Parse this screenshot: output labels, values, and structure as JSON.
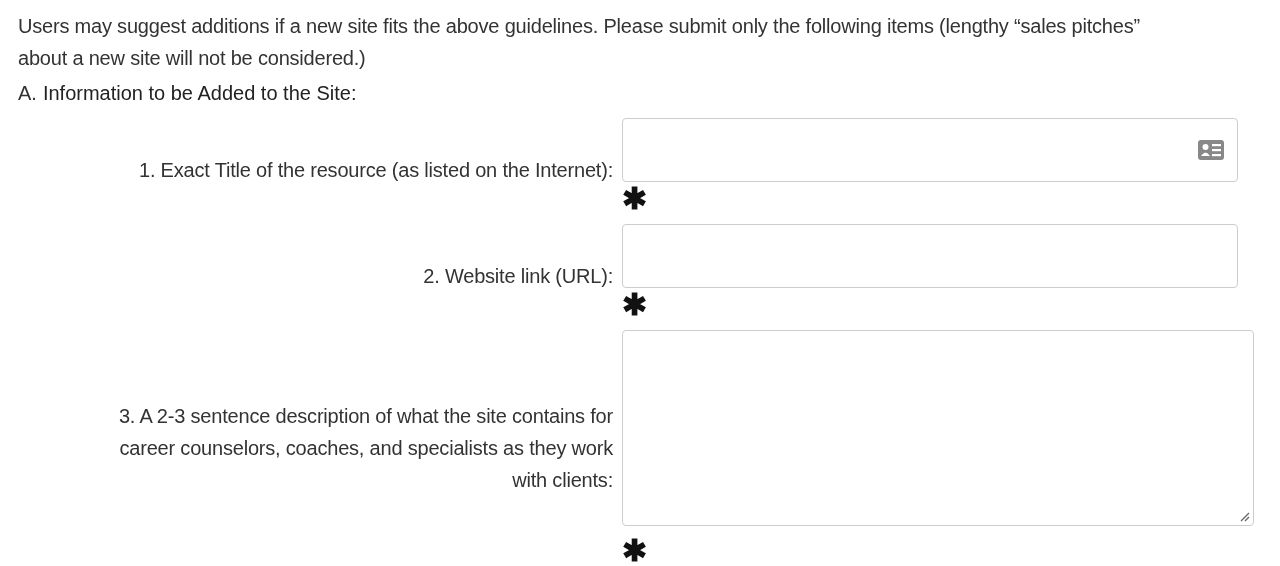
{
  "intro": "Users may suggest additions if a new site fits the above guidelines. Please submit only the following items (lengthy “sales pitches” about a new site will not be considered.)",
  "section": {
    "letter": "A.",
    "title": "Information to be Added to the Site:"
  },
  "fields": [
    {
      "kind": "input",
      "label": "1. Exact Title of the resource (as listed on the Internet):",
      "contact_icon": true,
      "required_mark": "✱"
    },
    {
      "kind": "input",
      "label": "2. Website link (URL):",
      "contact_icon": false,
      "required_mark": "✱"
    },
    {
      "kind": "textarea",
      "label": "3. A 2-3 sentence description of what the site contains for career counselors, coaches, and specialists as they work with clients:",
      "required_mark": "✱"
    }
  ]
}
